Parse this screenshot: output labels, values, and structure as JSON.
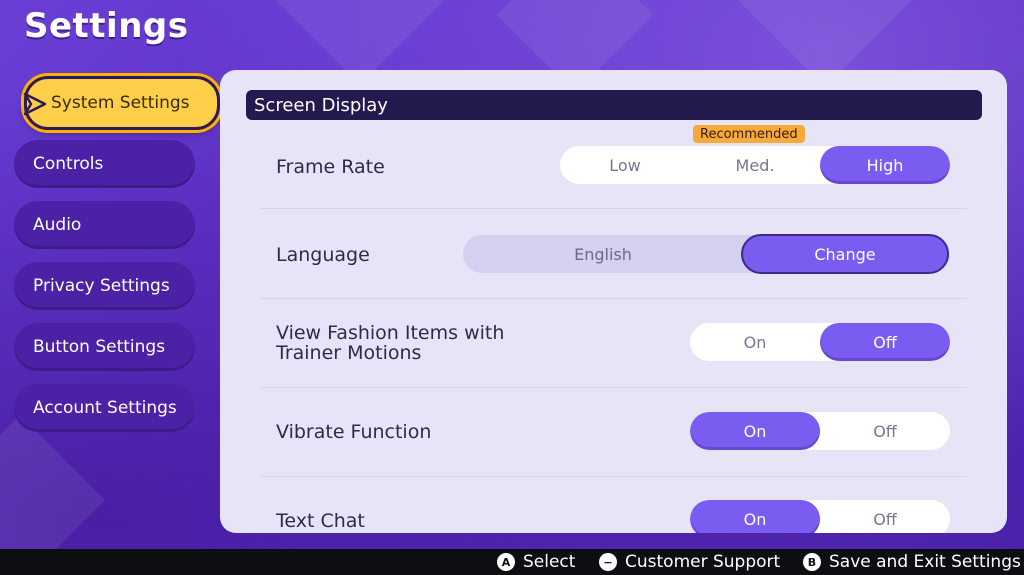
{
  "page": {
    "title": "Settings"
  },
  "sidebar": {
    "items": [
      {
        "label": "System Settings",
        "active": true
      },
      {
        "label": "Controls"
      },
      {
        "label": "Audio"
      },
      {
        "label": "Privacy Settings"
      },
      {
        "label": "Button Settings"
      },
      {
        "label": "Account Settings"
      }
    ]
  },
  "main": {
    "section_title": "Screen Display",
    "frame_rate": {
      "label": "Frame Rate",
      "badge": "Recommended",
      "options": [
        "Low",
        "Med.",
        "High"
      ],
      "selected": "High"
    },
    "language": {
      "label": "Language",
      "value": "English",
      "button": "Change"
    },
    "fashion": {
      "label_line1": "View Fashion Items with",
      "label_line2": "Trainer Motions",
      "options": [
        "On",
        "Off"
      ],
      "selected": "Off"
    },
    "vibrate": {
      "label": "Vibrate Function",
      "options": [
        "On",
        "Off"
      ],
      "selected": "On"
    },
    "text_chat": {
      "label": "Text Chat",
      "options": [
        "On",
        "Off"
      ],
      "selected": "On"
    }
  },
  "footer": {
    "select": {
      "glyph": "A",
      "label": "Select"
    },
    "support": {
      "glyph": "−",
      "label": "Customer Support"
    },
    "exit": {
      "glyph": "B",
      "label": "Save and Exit Settings"
    }
  },
  "colors": {
    "background": "#5a2ec6",
    "accent": "#7b5cf0",
    "active_item": "#ffcf4a",
    "header_bar": "#251a4e",
    "badge": "#f7a93a"
  }
}
